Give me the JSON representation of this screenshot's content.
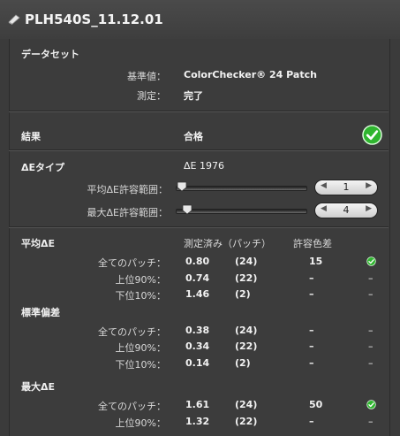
{
  "window": {
    "title": "PLH540S_11.12.01"
  },
  "dataset": {
    "header": "データセット",
    "reference_label": "基準値：",
    "reference_value": "ColorChecker® 24 Patch",
    "measure_label": "測定：",
    "measure_value": "完了"
  },
  "result": {
    "label": "結果",
    "value": "合格",
    "icon": "check-circle-icon",
    "color": "#2fb52f"
  },
  "deltaE": {
    "type_label": "ΔEタイプ",
    "type_value": "ΔE 1976",
    "avg_tolerance_label": "平均ΔE許容範囲：",
    "avg_tolerance_value": "1",
    "avg_slider_level": 0.0,
    "max_tolerance_label": "最大ΔE許容範囲：",
    "max_tolerance_value": "4",
    "max_slider_level": 0.05
  },
  "table": {
    "col_measured": "測定済み（パッチ）",
    "col_tolerance": "許容色差",
    "sections": [
      {
        "title": "平均ΔE",
        "rows": [
          {
            "label": "全てのパッチ：",
            "value": "0.80",
            "count": "(24)",
            "tolerance": "15",
            "status": "check"
          },
          {
            "label": "上位90%：",
            "value": "0.74",
            "count": "(22)",
            "tolerance": "–",
            "status": "–"
          },
          {
            "label": "下位10%：",
            "value": "1.46",
            "count": "(2)",
            "tolerance": "–",
            "status": "–"
          }
        ]
      },
      {
        "title": "標準偏差",
        "rows": [
          {
            "label": "全てのパッチ：",
            "value": "0.38",
            "count": "(24)",
            "tolerance": "–",
            "status": "–"
          },
          {
            "label": "上位90%：",
            "value": "0.34",
            "count": "(22)",
            "tolerance": "–",
            "status": "–"
          },
          {
            "label": "下位10%：",
            "value": "0.14",
            "count": "(2)",
            "tolerance": "–",
            "status": "–"
          }
        ]
      },
      {
        "title": "最大ΔE",
        "rows": [
          {
            "label": "全てのパッチ：",
            "value": "1.61",
            "count": "(24)",
            "tolerance": "50",
            "status": "check"
          },
          {
            "label": "上位90%：",
            "value": "1.32",
            "count": "(22)",
            "tolerance": "–",
            "status": "–"
          }
        ]
      }
    ]
  }
}
